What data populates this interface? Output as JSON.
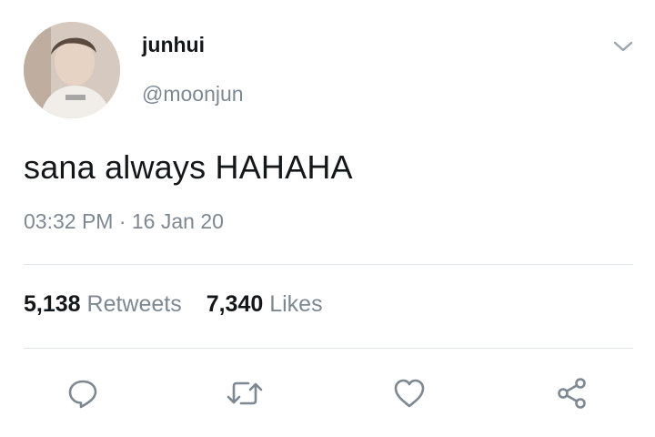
{
  "tweet": {
    "display_name": "junhui",
    "handle": "@moonjun",
    "text": "sana always HAHAHA",
    "timestamp": "03:32 PM · 16 Jan 20",
    "retweets": {
      "count": "5,138",
      "label": "Retweets"
    },
    "likes": {
      "count": "7,340",
      "label": "Likes"
    }
  },
  "icons": {
    "menu": "chevron-down-icon",
    "reply": "reply-icon",
    "retweet": "retweet-icon",
    "like": "heart-icon",
    "share": "share-icon"
  },
  "colors": {
    "text_primary": "#14171a",
    "text_secondary": "#7d8892",
    "icon": "#7d8892",
    "divider": "#e1e6ea",
    "background": "#ffffff"
  }
}
